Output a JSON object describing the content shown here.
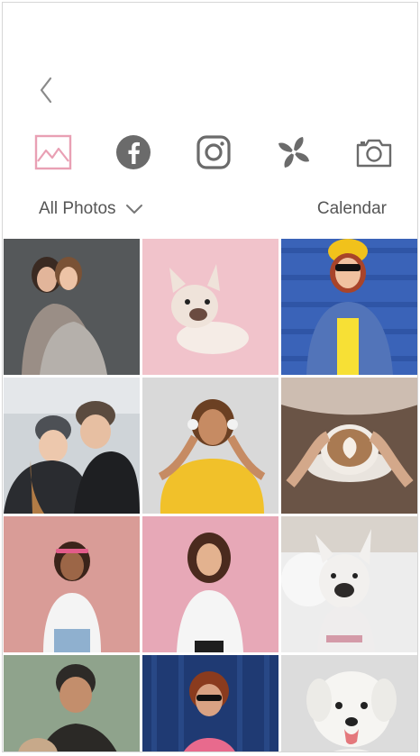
{
  "header": {
    "back_icon": "chevron-left-icon"
  },
  "sources": [
    {
      "name": "gallery",
      "icon": "gallery-icon",
      "active": true,
      "color": "#e9a0b4"
    },
    {
      "name": "facebook",
      "icon": "facebook-icon",
      "active": false,
      "color": "#6b6b6b"
    },
    {
      "name": "instagram",
      "icon": "instagram-icon",
      "active": false,
      "color": "#6b6b6b"
    },
    {
      "name": "pinwheel",
      "icon": "pinwheel-icon",
      "active": false,
      "color": "#6b6b6b"
    },
    {
      "name": "camera",
      "icon": "camera-icon",
      "active": false,
      "color": "#6b6b6b"
    }
  ],
  "filter": {
    "album_label": "All Photos",
    "calendar_label": "Calendar"
  },
  "photos": [
    {
      "bg": "#55585a",
      "subject": "two-women-hugging"
    },
    {
      "bg": "#f1c3cb",
      "subject": "french-bulldog-pink"
    },
    {
      "bg": "#3a63b8",
      "subject": "woman-yellow-hat"
    },
    {
      "bg": "#cfd4d8",
      "subject": "couple-beanies-snow"
    },
    {
      "bg": "#d9d9d9",
      "subject": "woman-headphones-yellow"
    },
    {
      "bg": "#6a5446",
      "subject": "latte-art-cup"
    },
    {
      "bg": "#d99c97",
      "subject": "woman-pink-headband"
    },
    {
      "bg": "#e7a8b7",
      "subject": "woman-white-shirt"
    },
    {
      "bg": "#ededed",
      "subject": "french-bulldog-bed"
    },
    {
      "bg": "#8fa38c",
      "subject": "man-with-dog"
    },
    {
      "bg": "#1f3a73",
      "subject": "woman-sunglasses-blue"
    },
    {
      "bg": "#dcdcdc",
      "subject": "white-fluffy-dog"
    }
  ],
  "colors": {
    "accent": "#e9a0b4",
    "icon_gray": "#6b6b6b",
    "text_gray": "#555555"
  }
}
